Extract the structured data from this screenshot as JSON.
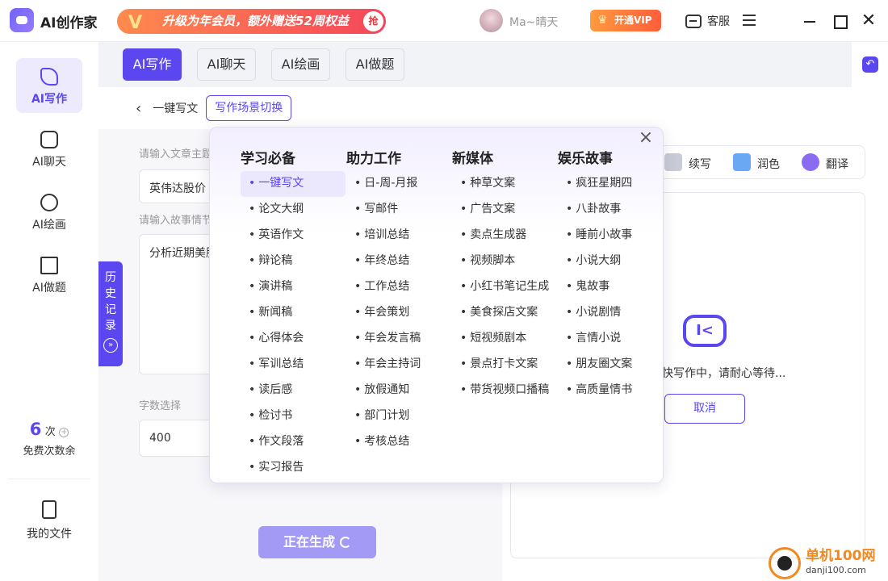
{
  "app": {
    "name": "AI创作家"
  },
  "promo": {
    "text": "升级为年会员，额外赠送52周权益",
    "badge": "抢"
  },
  "user": {
    "name": "Ma~晴天"
  },
  "vip_button": "开通VIP",
  "service": "客服",
  "sidebar": {
    "items": [
      {
        "label": "AI写作"
      },
      {
        "label": "AI聊天"
      },
      {
        "label": "AI绘画"
      },
      {
        "label": "AI做题"
      }
    ],
    "credits": {
      "count": "6",
      "unit": "次",
      "label": "免费次数余"
    },
    "my_files": "我的文件"
  },
  "tabs": [
    "AI写作",
    "AI聊天",
    "AI绘画",
    "AI做题"
  ],
  "breadcrumb": {
    "current": "一键写文",
    "switch": "写作场景切换"
  },
  "form": {
    "topic_label": "请输入文章主题",
    "topic_value": "英伟达股价",
    "plot_label": "请输入故事情节",
    "plot_value": "分析近期美股",
    "wordcount_label": "字数选择",
    "wordcount_value": "400"
  },
  "history": [
    "历",
    "史",
    "记",
    "录"
  ],
  "generate_button": "正在生成",
  "toolbar": {
    "continue": "续写",
    "polish": "润色",
    "translate": "翻译"
  },
  "output": {
    "waiting": "快写作中，请耐心等待...",
    "cancel": "取消"
  },
  "popup": {
    "columns": [
      {
        "title": "学习必备",
        "items": [
          "一键写文",
          "论文大纲",
          "英语作文",
          "辩论稿",
          "演讲稿",
          "新闻稿",
          "心得体会",
          "军训总结",
          "读后感",
          "检讨书",
          "作文段落",
          "实习报告"
        ],
        "selected": 0
      },
      {
        "title": "助力工作",
        "items": [
          "日-周-月报",
          "写邮件",
          "培训总结",
          "年终总结",
          "工作总结",
          "年会策划",
          "年会发言稿",
          "年会主持词",
          "放假通知",
          "部门计划",
          "考核总结"
        ]
      },
      {
        "title": "新媒体",
        "items": [
          "种草文案",
          "广告文案",
          "卖点生成器",
          "视频脚本",
          "小红书笔记生成",
          "美食探店文案",
          "短视频剧本",
          "景点打卡文案",
          "带货视频口播稿"
        ]
      },
      {
        "title": "娱乐故事",
        "items": [
          "疯狂星期四",
          "八卦故事",
          "睡前小故事",
          "小说大纲",
          "鬼故事",
          "小说剧情",
          "言情小说",
          "朋友圈文案",
          "高质量情书"
        ]
      }
    ]
  },
  "watermark": {
    "name": "单机100网",
    "url": "danji100.com"
  }
}
